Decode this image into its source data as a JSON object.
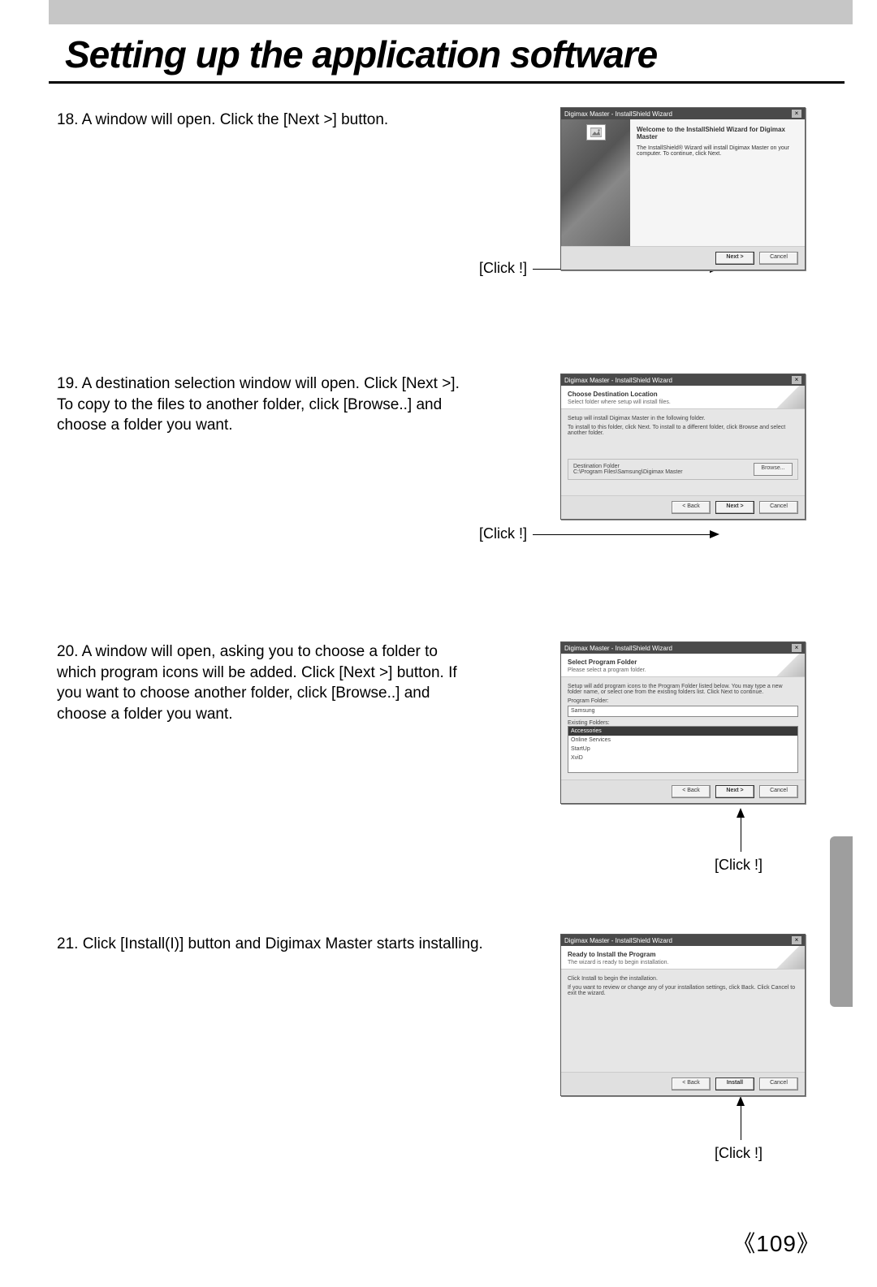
{
  "page": {
    "title": "Setting up the application software",
    "number": "《109》"
  },
  "labels": {
    "click": "[Click !]"
  },
  "steps": {
    "s18": {
      "num": "18.",
      "text": "A window will open. Click the [Next >] button."
    },
    "s19": {
      "num": "19.",
      "text": "A destination selection window will open. Click [Next >]. To copy to the files to another folder, click [Browse..] and choose a folder you want."
    },
    "s20": {
      "num": "20.",
      "text": "A window will open, asking you to choose a folder to which program icons will be added. Click [Next >] button. If you want to choose another folder, click [Browse..] and choose a folder you want."
    },
    "s21": {
      "num": "21.",
      "text": "Click [Install(I)] button and Digimax Master starts installing."
    }
  },
  "wizard": {
    "titlebar": "Digimax Master - InstallShield Wizard",
    "close": "×",
    "buttons": {
      "back": "< Back",
      "next": "Next >",
      "cancel": "Cancel",
      "install": "Install",
      "browse": "Browse..."
    },
    "w18": {
      "heading": "Welcome to the InstallShield Wizard for Digimax Master",
      "body": "The InstallShield® Wizard will install Digimax Master on your computer. To continue, click Next."
    },
    "w19": {
      "heading": "Choose Destination Location",
      "sub": "Select folder where setup will install files.",
      "body1": "Setup will install Digimax Master in the following folder.",
      "body2": "To install to this folder, click Next. To install to a different folder, click Browse and select another folder.",
      "destLabel": "Destination Folder",
      "destPath": "C:\\Program Files\\Samsung\\Digimax Master"
    },
    "w20": {
      "heading": "Select Program Folder",
      "sub": "Please select a program folder.",
      "body": "Setup will add program icons to the Program Folder listed below. You may type a new folder name, or select one from the existing folders list. Click Next to continue.",
      "pfLabel": "Program Folder:",
      "pfValue": "Samsung",
      "efLabel": "Existing Folders:",
      "efItems": [
        "Accessories",
        "Online Services",
        "StartUp",
        "XviD"
      ]
    },
    "w21": {
      "heading": "Ready to Install the Program",
      "sub": "The wizard is ready to begin installation.",
      "body1": "Click Install to begin the installation.",
      "body2": "If you want to review or change any of your installation settings, click Back. Click Cancel to exit the wizard."
    }
  }
}
